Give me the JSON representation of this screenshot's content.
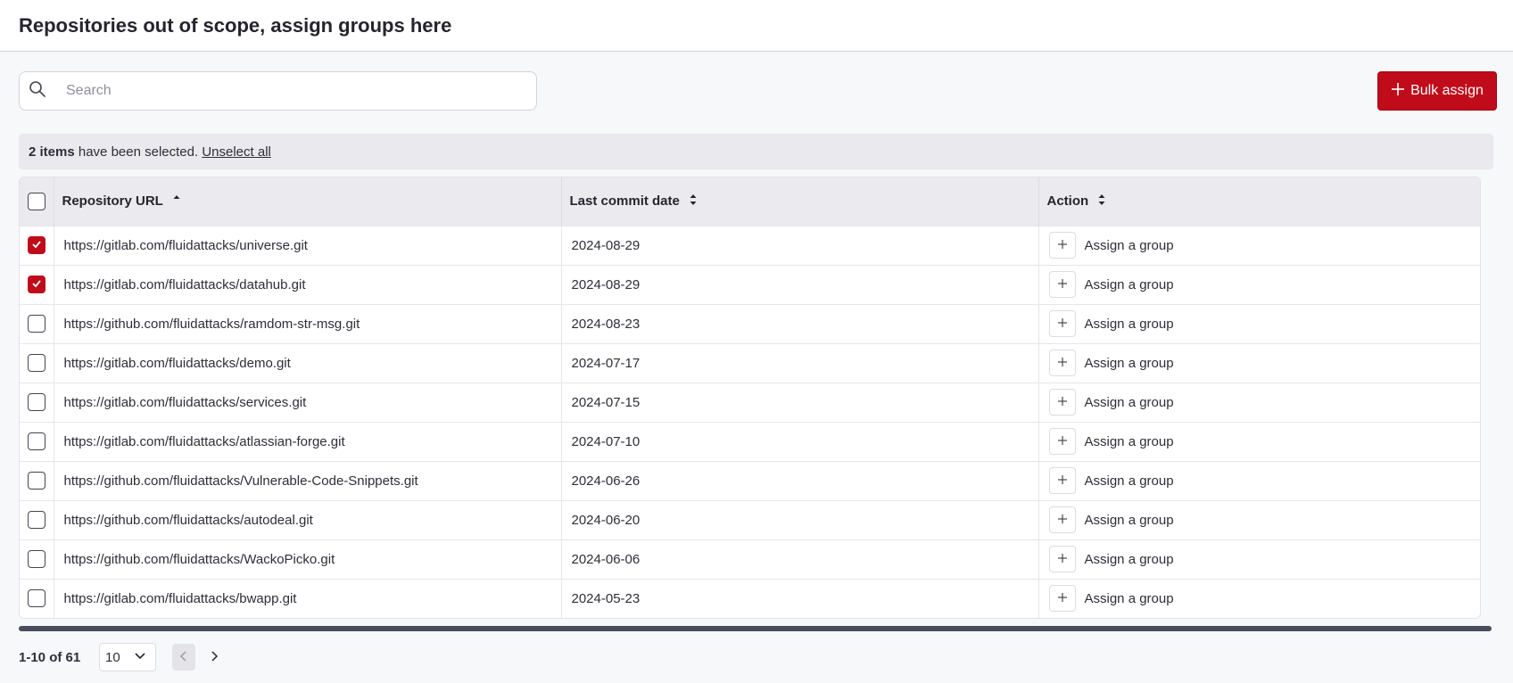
{
  "header": {
    "title": "Repositories out of scope, assign groups here"
  },
  "search": {
    "placeholder": "Search",
    "value": ""
  },
  "toolbar": {
    "bulk_assign_label": "Bulk assign"
  },
  "selection": {
    "count_label": "2 items",
    "message": "have been selected.",
    "unselect_label": "Unselect all"
  },
  "table": {
    "columns": [
      {
        "label": "Repository URL",
        "sort": "ascending"
      },
      {
        "label": "Last commit date",
        "sort": "none"
      },
      {
        "label": "Action",
        "sort": "none"
      }
    ],
    "rows": [
      {
        "url": "https://gitlab.com/fluidattacks/universe.git",
        "date": "2024-08-29",
        "action": "Assign a group",
        "checked": true
      },
      {
        "url": "https://gitlab.com/fluidattacks/datahub.git",
        "date": "2024-08-29",
        "action": "Assign a group",
        "checked": true
      },
      {
        "url": "https://github.com/fluidattacks/ramdom-str-msg.git",
        "date": "2024-08-23",
        "action": "Assign a group",
        "checked": false
      },
      {
        "url": "https://gitlab.com/fluidattacks/demo.git",
        "date": "2024-07-17",
        "action": "Assign a group",
        "checked": false
      },
      {
        "url": "https://gitlab.com/fluidattacks/services.git",
        "date": "2024-07-15",
        "action": "Assign a group",
        "checked": false
      },
      {
        "url": "https://gitlab.com/fluidattacks/atlassian-forge.git",
        "date": "2024-07-10",
        "action": "Assign a group",
        "checked": false
      },
      {
        "url": "https://github.com/fluidattacks/Vulnerable-Code-Snippets.git",
        "date": "2024-06-26",
        "action": "Assign a group",
        "checked": false
      },
      {
        "url": "https://github.com/fluidattacks/autodeal.git",
        "date": "2024-06-20",
        "action": "Assign a group",
        "checked": false
      },
      {
        "url": "https://github.com/fluidattacks/WackoPicko.git",
        "date": "2024-06-06",
        "action": "Assign a group",
        "checked": false
      },
      {
        "url": "https://gitlab.com/fluidattacks/bwapp.git",
        "date": "2024-05-23",
        "action": "Assign a group",
        "checked": false
      }
    ]
  },
  "pagination": {
    "range_label": "1-10 of 61",
    "page_size": "10"
  },
  "icons": {
    "search": "search-icon",
    "plus": "plus-icon",
    "check": "check-icon",
    "sort": "sort-icon",
    "chevron_down": "chevron-down-icon",
    "chevron_left": "chevron-left-icon",
    "chevron_right": "chevron-right-icon"
  },
  "colors": {
    "accent": "#bf0b1a",
    "header_bg": "#ebebef",
    "selection_bg": "#e9e9ee"
  }
}
